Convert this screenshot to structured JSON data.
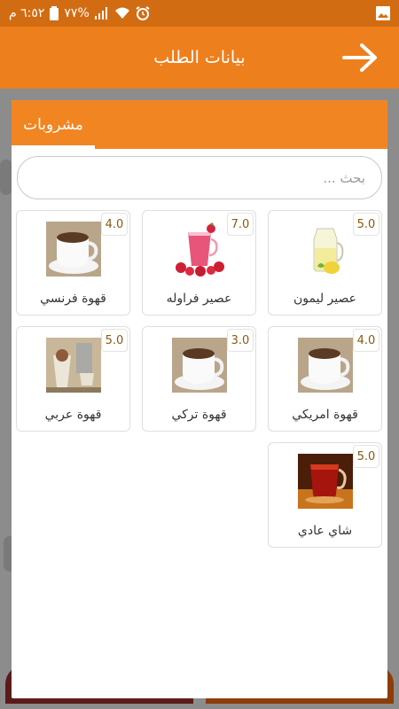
{
  "status_bar": {
    "time": "٦:٥٢ م",
    "battery": "٧٧%",
    "colors": {
      "bar": "#d26c12"
    }
  },
  "app_bar": {
    "title": "بيانات الطلب",
    "back_icon": "arrow-right-icon",
    "color": "#ee7f1d"
  },
  "dialog": {
    "tab_label": "مشروبات",
    "search_placeholder": "بحث ...",
    "accent": "#f18521",
    "items": [
      {
        "name": "عصير ليمون",
        "price": "5.0",
        "image": "lemon-juice-image"
      },
      {
        "name": "عصير فراوله",
        "price": "7.0",
        "image": "strawberry-juice-image"
      },
      {
        "name": "قهوة فرنسي",
        "price": "4.0",
        "image": "coffee-cup-image"
      },
      {
        "name": "قهوة امريكي",
        "price": "4.0",
        "image": "coffee-cup-image"
      },
      {
        "name": "قهوة تركي",
        "price": "3.0",
        "image": "coffee-cup-image"
      },
      {
        "name": "قهوة عربي",
        "price": "5.0",
        "image": "arabic-coffee-image"
      },
      {
        "name": "شاي عادي",
        "price": "5.0",
        "image": "tea-cup-image"
      }
    ]
  }
}
